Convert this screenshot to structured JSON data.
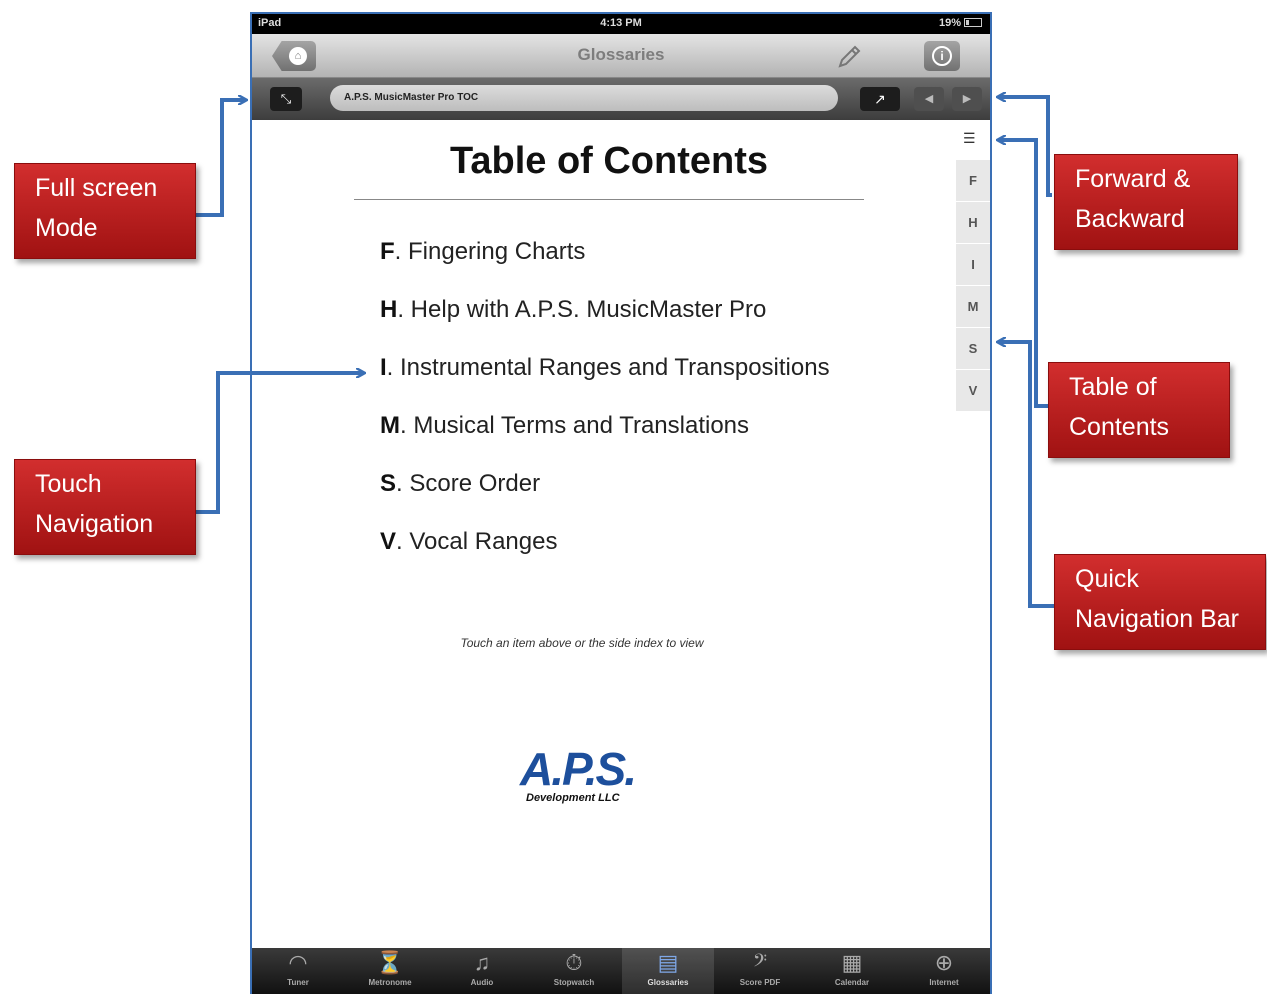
{
  "status_bar": {
    "device": "iPad",
    "time": "4:13 PM",
    "battery": "19%"
  },
  "nav_bar": {
    "title": "Glossaries"
  },
  "url_bar": {
    "field_text": "A.P.S. MusicMaster Pro TOC",
    "fullscreen_glyph": "⤡",
    "share_glyph": "↗",
    "back_glyph": "◀",
    "forward_glyph": "▶"
  },
  "document": {
    "title": "Table of Contents",
    "items": [
      {
        "letter": "F",
        "text": ". Fingering Charts"
      },
      {
        "letter": "H",
        "text": ". Help with A.P.S. MusicMaster Pro"
      },
      {
        "letter": "I",
        "text": ". Instrumental Ranges and Transpositions"
      },
      {
        "letter": "M",
        "text": ". Musical Terms and Translations"
      },
      {
        "letter": "S",
        "text": ". Score Order"
      },
      {
        "letter": "V",
        "text": ". Vocal Ranges"
      }
    ],
    "hint": "Touch an item above or the side index to view",
    "logo": {
      "mark": "A.P.S.",
      "sub": "Development LLC"
    }
  },
  "side_index": [
    "F",
    "H",
    "I",
    "M",
    "S",
    "V"
  ],
  "tab_bar": [
    {
      "label": "Tuner",
      "icon": "tuner-icon",
      "glyph": "◠"
    },
    {
      "label": "Metronome",
      "icon": "metronome-icon",
      "glyph": "⏳"
    },
    {
      "label": "Audio",
      "icon": "music-note-icon",
      "glyph": "♫"
    },
    {
      "label": "Stopwatch",
      "icon": "stopwatch-icon",
      "glyph": "⏱"
    },
    {
      "label": "Glossaries",
      "icon": "book-icon",
      "glyph": "▤",
      "active": true
    },
    {
      "label": "Score PDF",
      "icon": "bass-clef-icon",
      "glyph": "𝄢"
    },
    {
      "label": "Calendar",
      "icon": "calendar-icon",
      "glyph": "▦"
    },
    {
      "label": "Internet",
      "icon": "globe-icon",
      "glyph": "⊕"
    }
  ],
  "callouts": {
    "full_screen": "Full screen Mode",
    "touch_navigation": "Touch Navigation",
    "forward_backward": "Forward & Backward",
    "table_of_contents": "Table of Contents",
    "quick_navigation": "Quick Navigation Bar"
  },
  "colors": {
    "callout_red": "#c01f1f",
    "arrow_blue": "#3a6fb5",
    "active_tab": "#7fa8e8"
  }
}
